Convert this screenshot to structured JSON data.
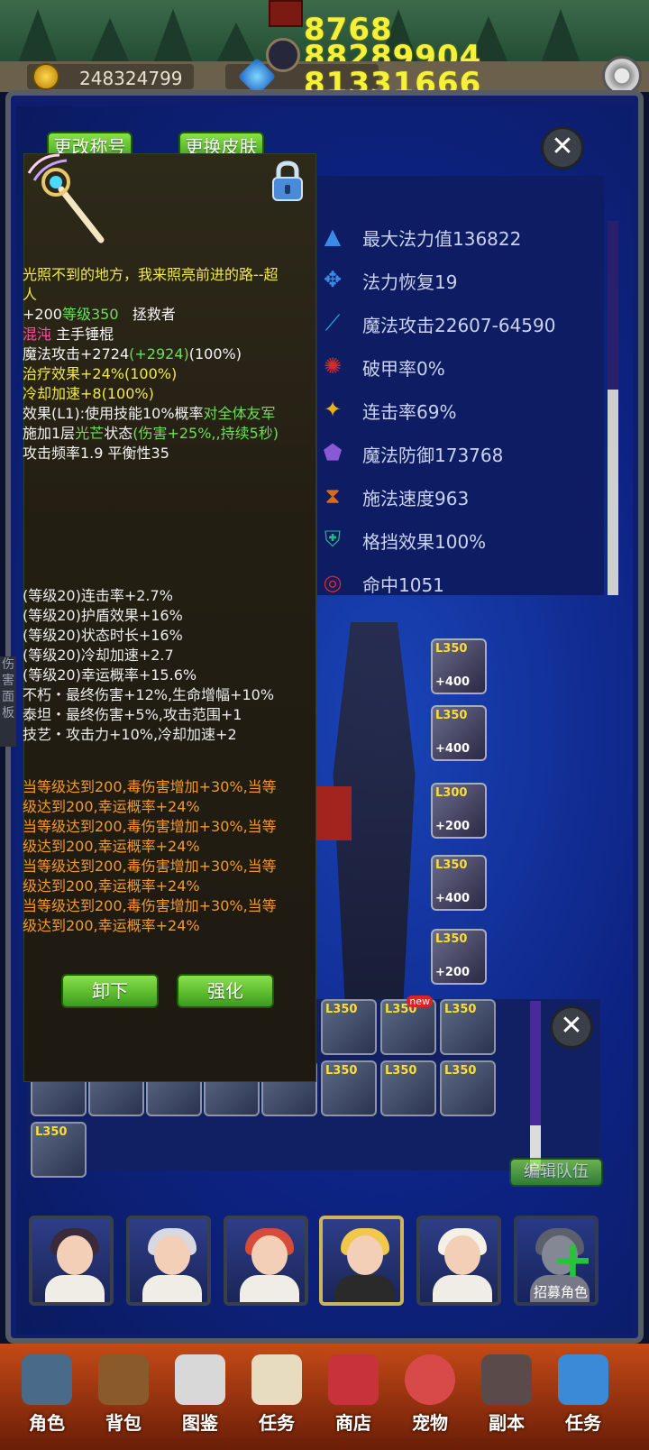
{
  "top": {
    "numbers": [
      "8768",
      "88289904",
      "81331666"
    ],
    "gold_amount": "248324799",
    "gem_amount": "81331666"
  },
  "header_buttons": {
    "rename": "更改称号",
    "skin": "更换皮肤"
  },
  "stats": [
    {
      "icon": "wizard-hat-icon",
      "label": "最大法力值136822",
      "color": "#3a8ae6"
    },
    {
      "icon": "mana-regen-icon",
      "label": "法力恢复19",
      "color": "#3a8ae6"
    },
    {
      "icon": "staff-icon",
      "label": "魔法攻击22607-64590",
      "color": "#2aa6d8"
    },
    {
      "icon": "armor-break-icon",
      "label": "破甲率0%",
      "color": "#d42a2a"
    },
    {
      "icon": "combo-star-icon",
      "label": "连击率69%",
      "color": "#e8b21c"
    },
    {
      "icon": "shield-icon",
      "label": "魔法防御173768",
      "color": "#8a5ad6"
    },
    {
      "icon": "hourglass-icon",
      "label": "施法速度963",
      "color": "#d86a1a"
    },
    {
      "icon": "block-icon",
      "label": "格挡效果100%",
      "color": "#2ab48a"
    },
    {
      "icon": "target-icon",
      "label": "命中1051",
      "color": "#d42a2a"
    }
  ],
  "equipment": [
    {
      "level": "L350",
      "plus": "+400"
    },
    {
      "level": "L350",
      "plus": "+400"
    },
    {
      "level": "L300",
      "plus": "+200"
    },
    {
      "level": "L350",
      "plus": "+400"
    },
    {
      "level": "L350",
      "plus": "+200"
    }
  ],
  "inventory": {
    "row1": [
      {
        "level": "L350",
        "new": ""
      },
      {
        "level": "L350",
        "new": "new"
      },
      {
        "level": "L350",
        "new": ""
      }
    ],
    "row2": [
      {
        "level": "L350"
      },
      {
        "level": "L350"
      },
      {
        "level": "L350"
      }
    ],
    "row3": [
      {
        "level": "L350"
      }
    ],
    "edit_team": "编辑队伍"
  },
  "tooltip": {
    "title": "光照不到的地方，我来照亮前进的路--超",
    "title2": "人",
    "level_plus": "+200",
    "level": "等级350",
    "rescuer": "拯救者",
    "rarity": "混沌",
    "weapon_type": "主手锤棍",
    "magic_attack": "魔法攻击+2724",
    "magic_attack_bonus": "(+2924)",
    "magic_attack_pct": "(100%)",
    "heal": "治疗效果+24%(100%)",
    "cooldown": "冷却加速+8(100%)",
    "effect_a": "效果(L1):使用技能10%概率",
    "effect_a2": "对全体友军",
    "effect_b": "施加1层",
    "effect_b2": "光芒",
    "effect_b3": "状态",
    "effect_b4": "(伤害+25%,,持续5秒)",
    "attack_freq": "攻击频率1.9 平衡性35",
    "affixes": [
      "(等级20)连击率+2.7%",
      "(等级20)护盾效果+16%",
      "(等级20)状态时长+16%",
      "(等级20)冷却加速+2.7",
      "(等级20)幸运概率+15.6%",
      "不朽・最终伤害+12%,生命增幅+10%",
      "泰坦・最终伤害+5%,攻击范围+1",
      "技艺・攻击力+10%,冷却加速+2"
    ],
    "set_bonus": [
      "当等级达到200,毒伤害增加+30%,当等",
      "级达到200,幸运概率+24%",
      "当等级达到200,毒伤害增加+30%,当等",
      "级达到200,幸运概率+24%",
      "当等级达到200,毒伤害增加+30%,当等",
      "级达到200,幸运概率+24%",
      "当等级达到200,毒伤害增加+30%,当等",
      "级达到200,幸运概率+24%"
    ],
    "unequip": "卸下",
    "enhance": "强化"
  },
  "side_tab": "伤害面板",
  "recruit": "招募角色",
  "nav": [
    {
      "label": "角色",
      "icon": "helmet-icon",
      "color": "#4a6a8a"
    },
    {
      "label": "背包",
      "icon": "backpack-icon",
      "color": "#8a5a2a"
    },
    {
      "label": "图鉴",
      "icon": "book-icon",
      "color": "#d8d8d8"
    },
    {
      "label": "任务",
      "icon": "scroll-icon",
      "color": "#e8dcc0"
    },
    {
      "label": "商店",
      "icon": "shop-icon",
      "color": "#c8323a"
    },
    {
      "label": "宠物",
      "icon": "meat-icon",
      "color": "#d84a4a"
    },
    {
      "label": "副本",
      "icon": "skull-gate-icon",
      "color": "#5a4a4a"
    },
    {
      "label": "任务",
      "icon": "calendar-icon",
      "color": "#3a8ad8"
    }
  ]
}
